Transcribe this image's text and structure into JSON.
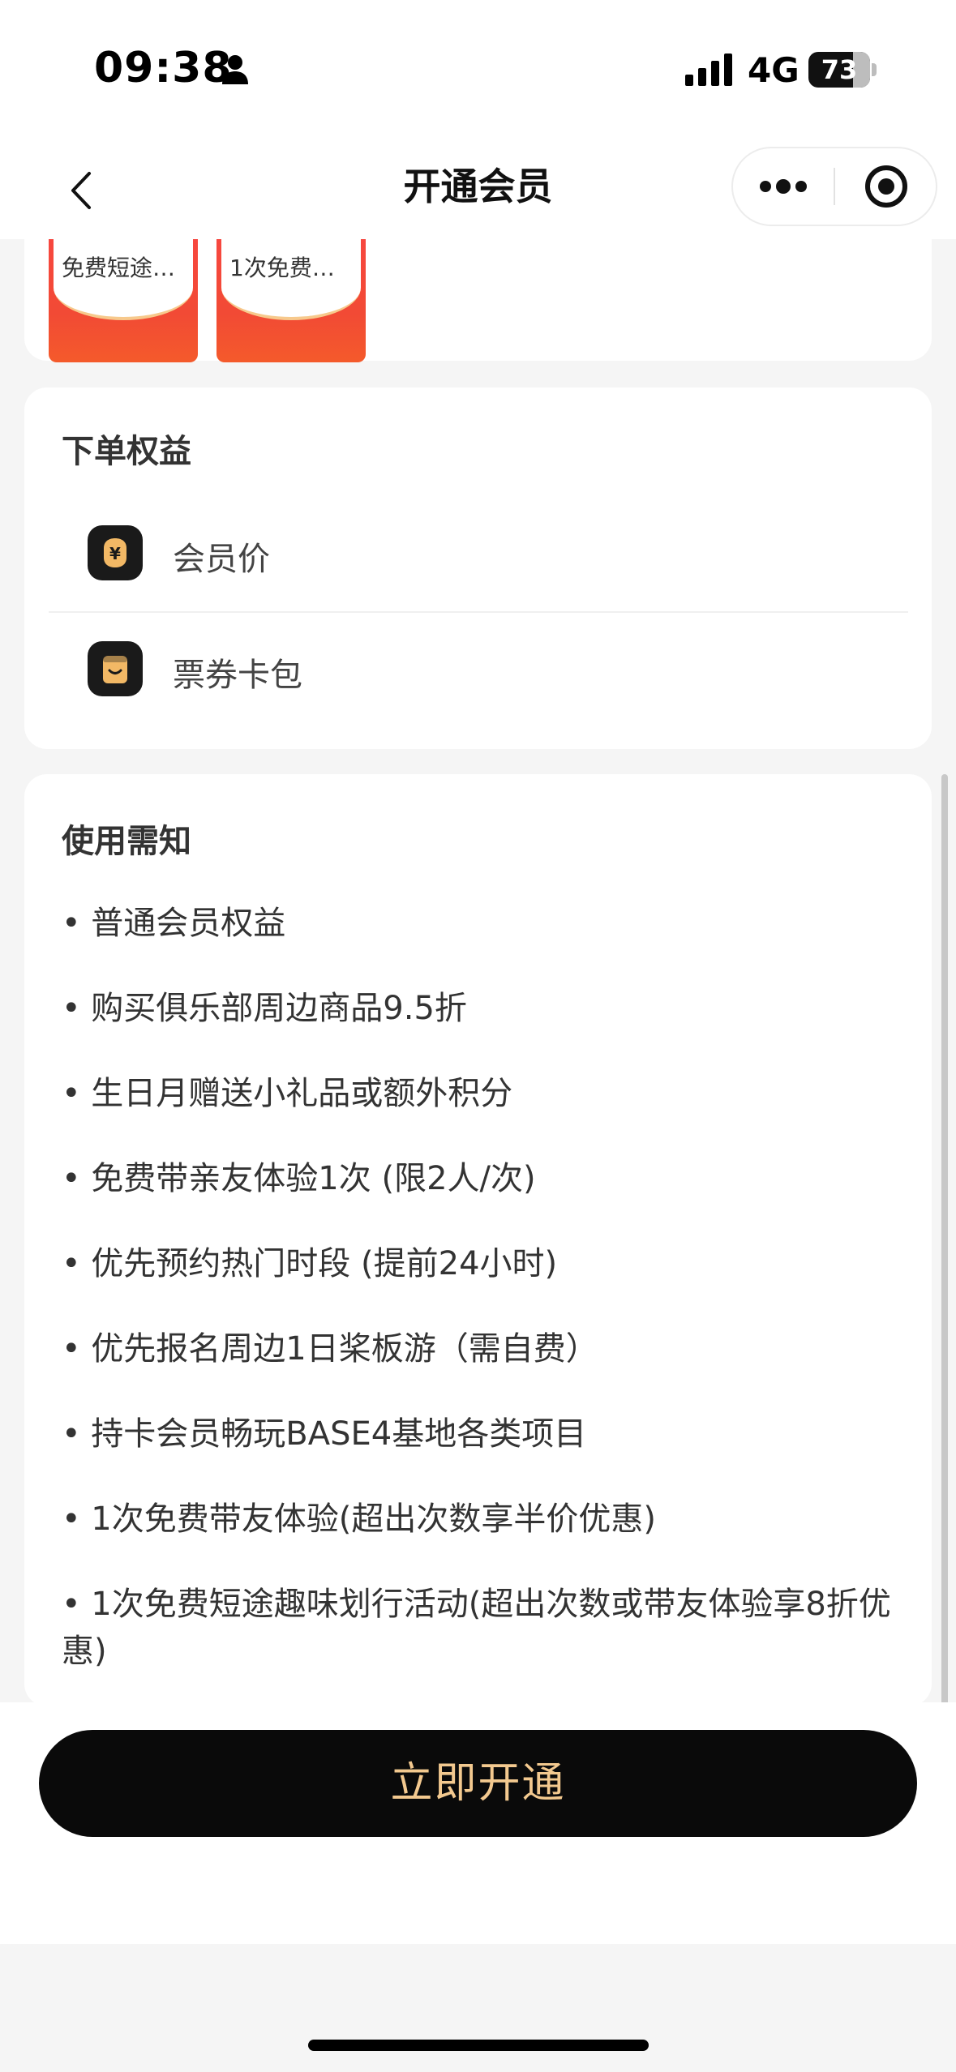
{
  "status_bar": {
    "time": "09:38",
    "network": "4G",
    "battery_level": "73",
    "battery_fraction": 0.73
  },
  "nav": {
    "title": "开通会员",
    "back_icon": "chevron-left-icon",
    "more_icon": "more-dots-icon",
    "close_icon": "target-close-icon"
  },
  "coupons": [
    {
      "label": "免费短途…"
    },
    {
      "label": "1次免费…"
    }
  ],
  "order_benefits": {
    "title": "下单权益",
    "items": [
      {
        "label": "会员价",
        "icon": "yen-icon"
      },
      {
        "label": "票券卡包",
        "icon": "ticket-wallet-icon"
      }
    ]
  },
  "notice": {
    "title": "使用需知",
    "items": [
      "• 普通会员权益",
      "• 购买俱乐部周边商品9.5折",
      "• 生日月赠送小礼品或额外积分",
      "• 免费带亲友体验1次 (限2人/次)",
      "• 优先预约热门时段 (提前24小时)",
      "• 优先报名周边1日桨板游（需自费）",
      "• 持卡会员畅玩BASE4基地各类项目",
      "• 1次免费带友体验(超出次数享半价优惠)",
      "• 1次免费短途趣味划行活动(超出次数或带友体验享8折优惠)"
    ]
  },
  "bottom": {
    "open_button_label": "立即开通"
  },
  "colors": {
    "button_bg": "#0a0a0a",
    "button_text": "#f3c98f",
    "coupon_red": "#f24a35"
  }
}
